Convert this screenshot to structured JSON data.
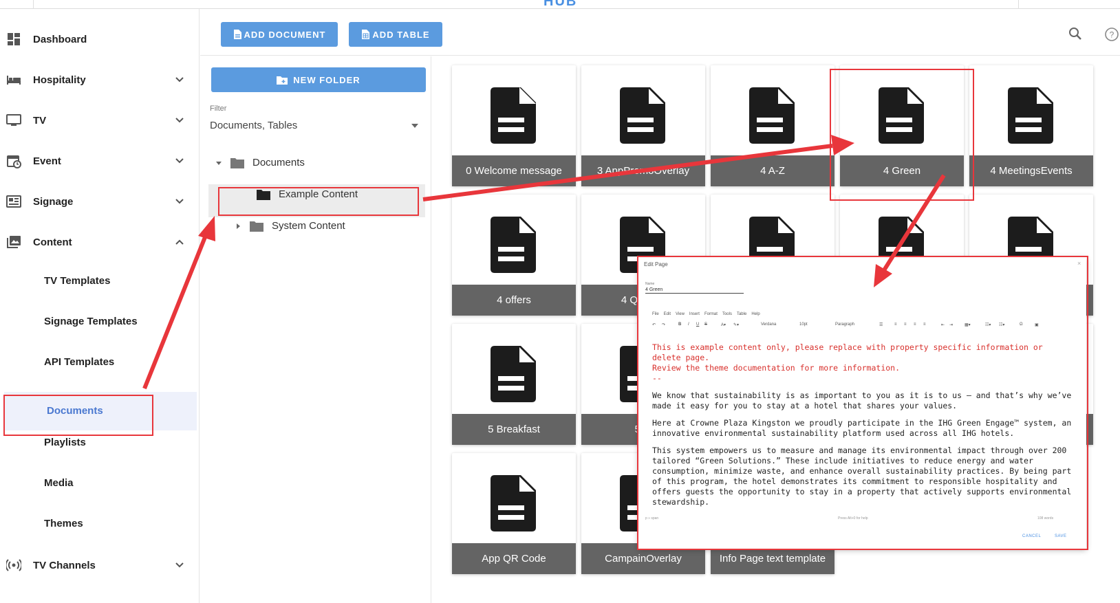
{
  "sidebar": {
    "items": [
      {
        "label": "Dashboard",
        "icon": "dashboard-icon"
      },
      {
        "label": "Hospitality",
        "icon": "bed-icon"
      },
      {
        "label": "TV",
        "icon": "tv-icon"
      },
      {
        "label": "Event",
        "icon": "calendar-icon"
      },
      {
        "label": "Signage",
        "icon": "signage-icon"
      },
      {
        "label": "Content",
        "icon": "photo-library-icon"
      }
    ],
    "content_sub": [
      "TV Templates",
      "Signage Templates",
      "API Templates",
      "Documents",
      "Playlists",
      "Media",
      "Themes"
    ],
    "tv_channels": "TV Channels"
  },
  "toolbar": {
    "add_document": "ADD DOCUMENT",
    "add_table": "ADD TABLE"
  },
  "folders": {
    "new_folder": "NEW FOLDER",
    "filter_label": "Filter",
    "filter_value": "Documents, Tables",
    "tree": [
      "Documents",
      "Example Content",
      "System Content"
    ]
  },
  "documents": [
    "0 Welcome message",
    "3 AppPromoOverlay",
    "4 A-Z",
    "4 Green",
    "4 MeetingsEvents",
    "4 offers",
    "4 QR Info",
    "5 Breakfast",
    "5 In",
    "App QR Code",
    "CampainOverlay",
    "Info Page text template"
  ],
  "dialog": {
    "title": "Edit Page",
    "close": "×",
    "name_label": "Name",
    "name_value": "4 Green",
    "menu": [
      "File",
      "Edit",
      "View",
      "Insert",
      "Format",
      "Tools",
      "Table",
      "Help"
    ],
    "font": "Verdana",
    "size": "10pt",
    "block": "Paragraph",
    "warning_line1": "This is example content only, please replace with property specific information or delete page.",
    "warning_line2": "Review the theme documentation for more information.",
    "dashes": "--",
    "para1": "We know that sustainability is as important to you as it is to us – and that’s why we’ve made it easy for you to stay at a hotel that shares your values.",
    "para2": "Here at Crowne Plaza Kingston we proudly participate in the IHG Green Engage™ system, an innovative environmental sustainability platform used across all IHG hotels.",
    "para3": "This system empowers us to measure and manage its environmental impact through over 200 tailored “Green Solutions.” These include initiatives to reduce energy and water consumption, minimize waste, and enhance overall sustainability practices. By being part of this program, the hotel demonstrates its commitment to responsible hospitality and offers guests the opportunity to stay in a property that actively supports environmental stewardship.",
    "status_left": "p » span",
    "status_mid": "Press Alt+0 for help",
    "status_right": "108 words",
    "cancel": "CANCEL",
    "save": "SAVE"
  },
  "colors": {
    "accent": "#5b9bdf",
    "card_bar": "#646464",
    "annotation": "#e8363b"
  }
}
